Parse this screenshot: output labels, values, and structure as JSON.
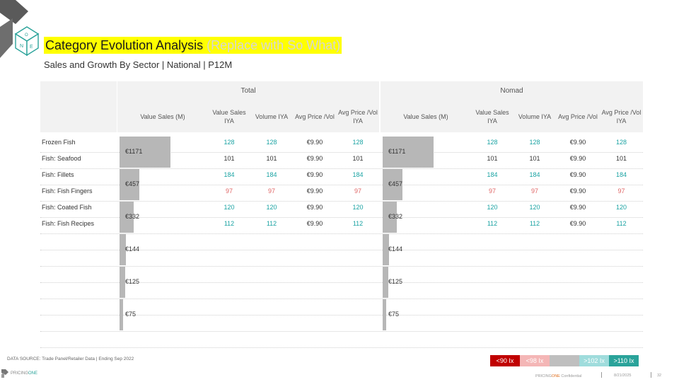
{
  "title": "Category Evolution Analysis",
  "title_placeholder": "(Replace with So What)",
  "subtitle": "Sales and Growth By Sector | National | P12M",
  "groups": [
    "Total",
    "Nomad"
  ],
  "columns": [
    "Value Sales (M)",
    "Value Sales IYA",
    "Volume IYA",
    "Avg Price /Vol",
    "Avg Price /Vol IYA"
  ],
  "rows": [
    {
      "label": "Frozen Fish",
      "total": [
        "128",
        "128",
        "€9.90",
        "128"
      ],
      "nomad": [
        "128",
        "128",
        "€9.90",
        "128"
      ]
    },
    {
      "label": "Fish: Seafood",
      "total": [
        "101",
        "101",
        "€9.90",
        "101"
      ],
      "nomad": [
        "101",
        "101",
        "€9.90",
        "101"
      ]
    },
    {
      "label": "Fish: Fillets",
      "total": [
        "184",
        "184",
        "€9.90",
        "184"
      ],
      "nomad": [
        "184",
        "184",
        "€9.90",
        "184"
      ]
    },
    {
      "label": "Fish: Fish Fingers",
      "total": [
        "97",
        "97",
        "€9.90",
        "97"
      ],
      "nomad": [
        "97",
        "97",
        "€9.90",
        "97"
      ]
    },
    {
      "label": "Fish: Coated Fish",
      "total": [
        "120",
        "120",
        "€9.90",
        "120"
      ],
      "nomad": [
        "120",
        "120",
        "€9.90",
        "120"
      ]
    },
    {
      "label": "Fish: Fish Recipes",
      "total": [
        "112",
        "112",
        "€9.90",
        "112"
      ],
      "nomad": [
        "112",
        "112",
        "€9.90",
        "112"
      ]
    }
  ],
  "chart_data": {
    "type": "bar",
    "orientation": "horizontal",
    "series": [
      {
        "name": "Total",
        "values": [
          1171,
          457,
          332,
          144,
          125,
          75
        ]
      },
      {
        "name": "Nomad",
        "values": [
          1171,
          457,
          332,
          144,
          125,
          75
        ]
      }
    ],
    "labels": [
      "€1171",
      "€457",
      "€332",
      "€144",
      "€125",
      "€75"
    ],
    "xlim": [
      0,
      1171
    ]
  },
  "legend": [
    {
      "label": "<90 Ix",
      "color": "#c00000"
    },
    {
      "label": "<98 Ix",
      "color": "#f4b6b6"
    },
    {
      "label": "",
      "color": "#bfbfbf"
    },
    {
      "label": ">102 Ix",
      "color": "#9fdcdc"
    },
    {
      "label": ">110 Ix",
      "color": "#2aa39a"
    }
  ],
  "colors": {
    "growth": "#1aa3a3",
    "flat": "#333333",
    "decline": "#e06666",
    "bar": "#b7b7b7"
  },
  "footer": {
    "source": "DATA SOURCE: Trade Panel/Retailer Data | Ending Sep 2022",
    "brand_a": "PRICING",
    "brand_b": "ONE",
    "confidential_a": "PRICING",
    "confidential_b": "ONE",
    "confidential_c": "Confidential",
    "date": "8/21/2025",
    "page": "32"
  }
}
